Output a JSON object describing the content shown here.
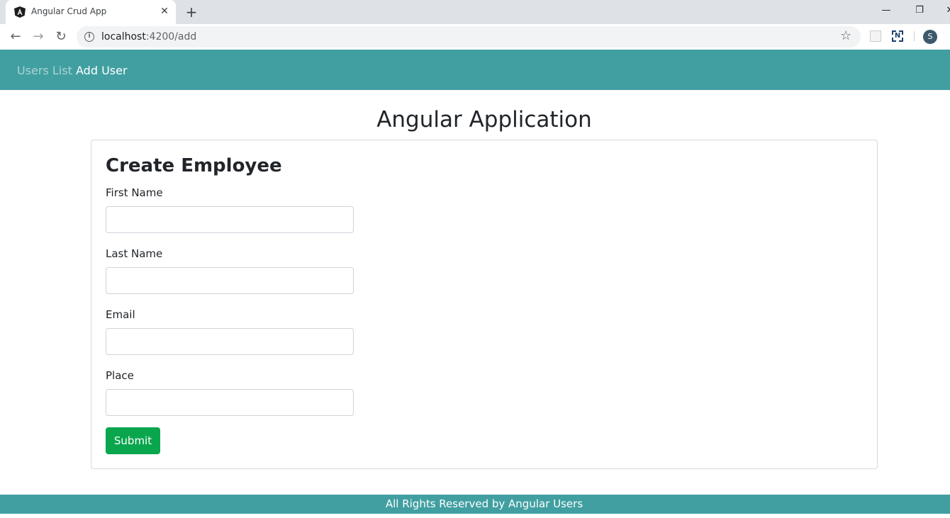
{
  "browser": {
    "tab_title": "Angular Crud App",
    "tab_close": "✕",
    "new_tab": "+",
    "url_host": "localhost",
    "url_path": ":4200/add",
    "profile_initial": "S",
    "icons": [
      "angular-icon",
      "back-icon",
      "forward-icon",
      "reload-icon",
      "info-icon",
      "star-icon",
      "extension-icon",
      "profile-icon"
    ]
  },
  "navbar": {
    "links": [
      {
        "label": "Users List",
        "active": false
      },
      {
        "label": "Add User",
        "active": true
      }
    ]
  },
  "page": {
    "title": "Angular Application"
  },
  "form": {
    "title": "Create Employee",
    "fields": [
      {
        "label": "First Name",
        "value": ""
      },
      {
        "label": "Last Name",
        "value": ""
      },
      {
        "label": "Email",
        "value": ""
      },
      {
        "label": "Place",
        "value": ""
      }
    ],
    "submit_label": "Submit"
  },
  "footer": {
    "text": "All Rights Reserved by Angular Users"
  },
  "colors": {
    "navbar": "#419fa1",
    "submit": "#0aa64e"
  }
}
